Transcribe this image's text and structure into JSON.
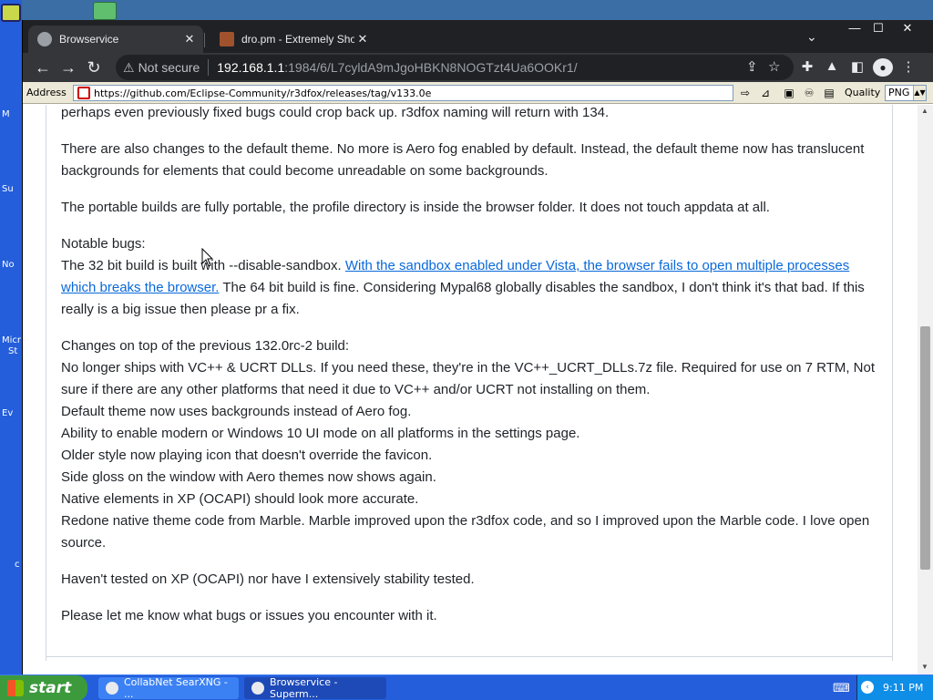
{
  "desktop": {
    "labels": [
      "M",
      "Su",
      "No",
      "Micr",
      "St",
      "Ev",
      "c"
    ]
  },
  "browser": {
    "tabs": [
      {
        "title": "Browservice",
        "active": true
      },
      {
        "title": "dro.pm - Extremely Short",
        "active": false
      }
    ],
    "window_controls": {
      "minimize": "—",
      "maximize": "☐",
      "close": "✕"
    },
    "security_label": "Not secure",
    "url_host": "192.168.1.1",
    "url_path": ":1984/6/L7cyldA9mJgoHBKN8NOGTzt4Ua6OOKr1/"
  },
  "address_bar": {
    "label": "Address",
    "url": "https://github.com/Eclipse-Community/r3dfox/releases/tag/v133.0e",
    "quality_label": "Quality",
    "quality_value": "PNG"
  },
  "article": {
    "p0": "perhaps even previously fixed bugs could crop back up. r3dfox naming will return with 134.",
    "p1": "There are also changes to the default theme. No more is Aero fog enabled by default. Instead, the default theme now has translucent backgrounds for elements that could become unreadable on some backgrounds.",
    "p2": "The portable builds are fully portable, the profile directory is inside the browser folder. It does not touch appdata at all.",
    "bugs_heading": "Notable bugs:",
    "bugs_pre": "The 32 bit build is built with --disable-sandbox. ",
    "bugs_link": "With the sandbox enabled under Vista, the browser fails to open multiple processes which breaks the browser.",
    "bugs_post": " The 64 bit build is fine. Considering Mypal68 globally disables the sandbox, I don't think it's that bad. If this really is a big issue then please pr a fix.",
    "changes": [
      "Changes on top of the previous 132.0rc-2 build:",
      "No longer ships with VC++ & UCRT DLLs. If you need these, they're in the VC++_UCRT_DLLs.7z file. Required for use on 7 RTM, Not sure if there are any other platforms that need it due to VC++ and/or UCRT not installing on them.",
      "Default theme now uses backgrounds instead of Aero fog.",
      "Ability to enable modern or Windows 10 UI mode on all platforms in the settings page.",
      "Older style now playing icon that doesn't override the favicon.",
      "Side gloss on the window with Aero themes now shows again.",
      "Native elements in XP (OCAPI) should look more accurate.",
      "Redone native theme code from Marble. Marble improved upon the r3dfox code, and so I improved upon the Marble code. I love open source."
    ],
    "p_tested": "Haven't tested on XP (OCAPI) nor have I extensively stability tested.",
    "p_last": "Please let me know what bugs or issues you encounter with it."
  },
  "taskbar": {
    "start_label": "start",
    "items": [
      {
        "label": "CollabNet SearXNG - ..."
      },
      {
        "label": "Browservice - Superm..."
      }
    ],
    "time": "9:11 PM"
  },
  "colors": {
    "link": "#0969da",
    "taskbar": "#245edb",
    "start": "#3c9a3c"
  }
}
